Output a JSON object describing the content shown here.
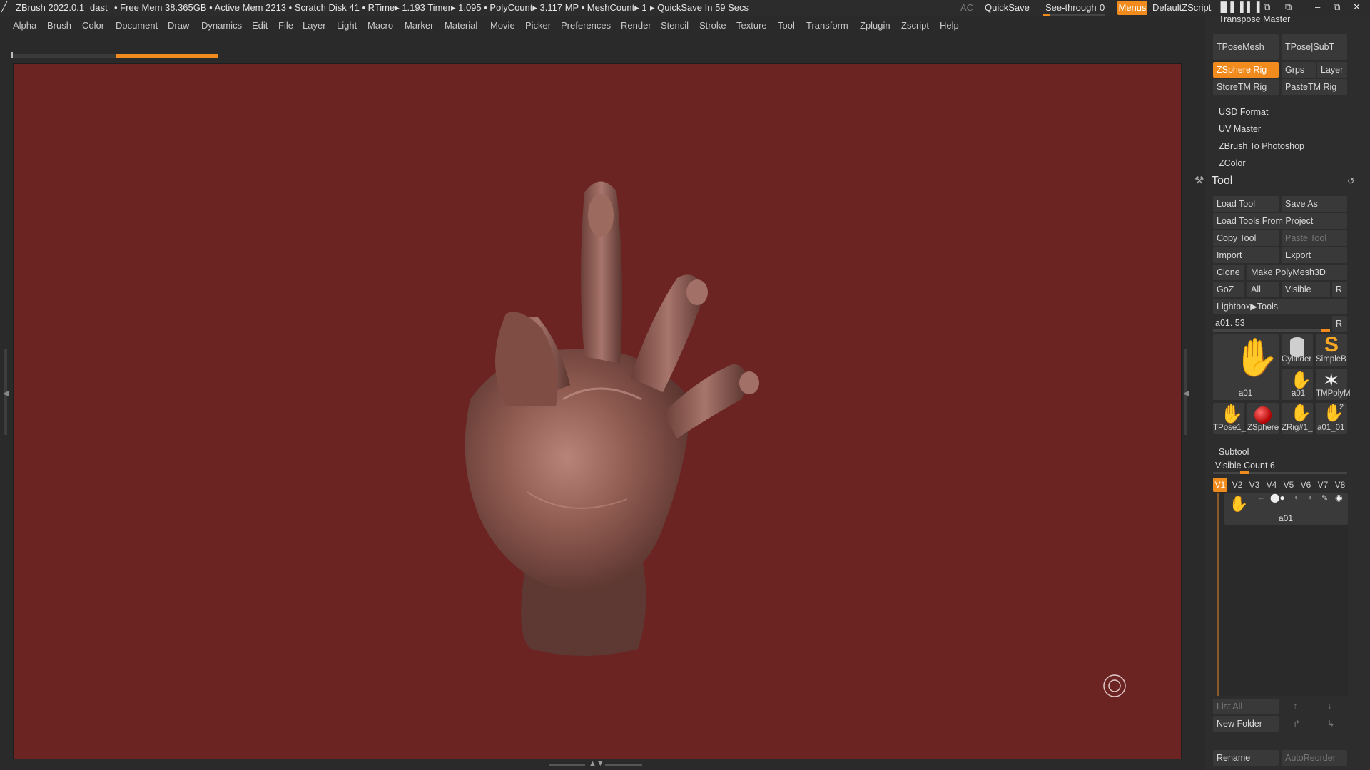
{
  "titlebar": {
    "app": "ZBrush 2022.0.1",
    "doc": "dast",
    "stats": "• Free Mem 38.365GB • Active Mem 2213 • Scratch Disk 41 •  RTime▸ 1.193 Timer▸ 1.095 • PolyCount▸ 3.117 MP  • MeshCount▸ 1",
    "quicksave_timer": "▸ QuickSave In 59 Secs",
    "ac": "AC",
    "quicksave": "QuickSave",
    "see_through_label": "See-through",
    "see_through_value": "0",
    "see_through_level": 0.1,
    "menus": "Menus",
    "default_zscript": "DefaultZScript"
  },
  "menu": [
    "Alpha",
    "Brush",
    "Color",
    "Document",
    "Draw",
    "Dynamics",
    "Edit",
    "File",
    "Layer",
    "Light",
    "Macro",
    "Marker",
    "Material",
    "Movie",
    "Picker",
    "Preferences",
    "Render",
    "Stencil",
    "Stroke",
    "Texture",
    "Tool",
    "Transform",
    "Zplugin",
    "Zscript",
    "Help"
  ],
  "panel": {
    "transpose_master": "Transpose Master",
    "tposemesh": "TPoseMesh",
    "tpose_subt": "TPose|SubT",
    "zsphere_rig": "ZSphere Rig",
    "grps": "Grps",
    "layer": "Layer",
    "storetm_rig": "StoreTM Rig",
    "pastetm_rig": "PasteTM Rig",
    "plugins": [
      "USD Format",
      "UV Master",
      "ZBrush To Photoshop",
      "ZColor"
    ],
    "tool_title": "Tool",
    "load_tool": "Load Tool",
    "save_as": "Save As",
    "load_from_project": "Load Tools From Project",
    "copy_tool": "Copy Tool",
    "paste_tool": "Paste Tool",
    "import": "Import",
    "export": "Export",
    "clone": "Clone",
    "make_polymesh": "Make PolyMesh3D",
    "goz": "GoZ",
    "all": "All",
    "visible": "Visible",
    "r": "R",
    "lightbox_tools": "Lightbox▶Tools",
    "tool_slider": "a01. 53",
    "tool_slider_r": "R",
    "thumbs": {
      "main": "a01",
      "cylinder": "Cylinder",
      "simpleb": "SimpleB",
      "a01_small": "a01",
      "tmpoly": "TMPolyM",
      "tpose1": "TPose1_",
      "zsphere": "ZSphere",
      "zrig": "ZRig#1_",
      "a01_01": "a01_01",
      "a01_01_count": "2"
    },
    "subtool": "Subtool",
    "visible_count": "Visible Count 6",
    "vtabs": [
      "V1",
      "V2",
      "V3",
      "V4",
      "V5",
      "V6",
      "V7",
      "V8"
    ],
    "subtool_item": "a01",
    "list_all": "List All",
    "new_folder": "New Folder",
    "rename": "Rename",
    "autoreorder": "AutoReorder"
  }
}
